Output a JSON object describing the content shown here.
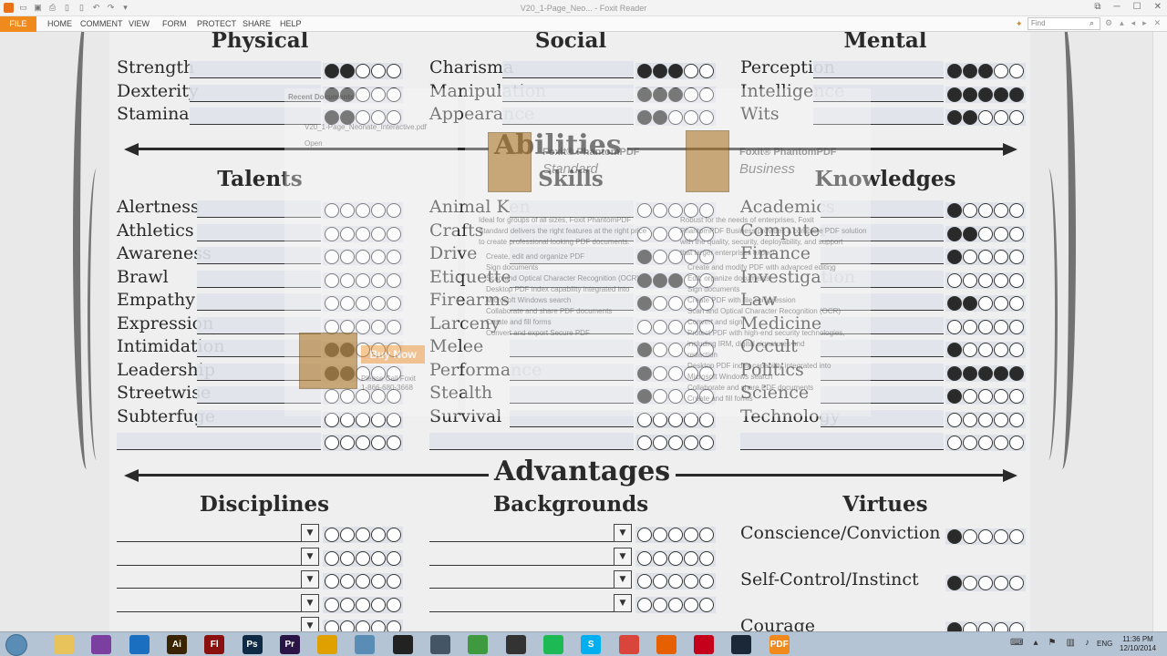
{
  "window": {
    "title": "V20_1-Page_Neo... - Foxit Reader",
    "controls": [
      "restore",
      "minimize",
      "maximize",
      "close"
    ]
  },
  "ribbon": {
    "file": "FILE",
    "tabs": [
      "HOME",
      "COMMENT",
      "VIEW",
      "FORM",
      "PROTECT",
      "SHARE",
      "HELP"
    ],
    "find_placeholder": "Find"
  },
  "sheet": {
    "attributes": {
      "headers": [
        "Physical",
        "Social",
        "Mental"
      ],
      "columns": [
        [
          {
            "label": "Strength",
            "filled": 2
          },
          {
            "label": "Dexterity",
            "filled": 2
          },
          {
            "label": "Stamina",
            "filled": 2
          }
        ],
        [
          {
            "label": "Charisma",
            "filled": 3
          },
          {
            "label": "Manipulation",
            "filled": 3
          },
          {
            "label": "Appearance",
            "filled": 2
          }
        ],
        [
          {
            "label": "Perception",
            "filled": 3
          },
          {
            "label": "Intelligence",
            "filled": 5
          },
          {
            "label": "Wits",
            "filled": 2
          }
        ]
      ]
    },
    "abilities": {
      "title": "Abilities",
      "headers": [
        "Talents",
        "Skills",
        "Knowledges"
      ],
      "columns": [
        [
          {
            "label": "Alertness",
            "filled": 0
          },
          {
            "label": "Athletics",
            "filled": 0
          },
          {
            "label": "Awareness",
            "filled": 0
          },
          {
            "label": "Brawl",
            "filled": 0
          },
          {
            "label": "Empathy",
            "filled": 0
          },
          {
            "label": "Expression",
            "filled": 0
          },
          {
            "label": "Intimidation",
            "filled": 2
          },
          {
            "label": "Leadership",
            "filled": 2
          },
          {
            "label": "Streetwise",
            "filled": 0
          },
          {
            "label": "Subterfuge",
            "filled": 0
          },
          {
            "label": "",
            "filled": 0
          }
        ],
        [
          {
            "label": "Animal Ken",
            "filled": 0
          },
          {
            "label": "Crafts",
            "filled": 0
          },
          {
            "label": "Drive",
            "filled": 1
          },
          {
            "label": "Etiquette",
            "filled": 3
          },
          {
            "label": "Firearms",
            "filled": 1
          },
          {
            "label": "Larceny",
            "filled": 0
          },
          {
            "label": "Melee",
            "filled": 1
          },
          {
            "label": "Performance",
            "filled": 1
          },
          {
            "label": "Stealth",
            "filled": 1
          },
          {
            "label": "Survival",
            "filled": 0
          },
          {
            "label": "",
            "filled": 0
          }
        ],
        [
          {
            "label": "Academics",
            "filled": 1
          },
          {
            "label": "Computer",
            "filled": 2
          },
          {
            "label": "Finance",
            "filled": 1
          },
          {
            "label": "Investigation",
            "filled": 0
          },
          {
            "label": "Law",
            "filled": 2
          },
          {
            "label": "Medicine",
            "filled": 0
          },
          {
            "label": "Occult",
            "filled": 1
          },
          {
            "label": "Politics",
            "filled": 5
          },
          {
            "label": "Science",
            "filled": 1
          },
          {
            "label": "Technology",
            "filled": 0
          },
          {
            "label": "",
            "filled": 0
          }
        ]
      ]
    },
    "advantages": {
      "title": "Advantages",
      "headers": [
        "Disciplines",
        "Backgrounds",
        "Virtues"
      ],
      "disciplines_rows": 5,
      "backgrounds_rows": 4,
      "virtues": [
        {
          "label": "Conscience/Conviction",
          "filled": 1
        },
        {
          "label": "Self-Control/Instinct",
          "filled": 1
        },
        {
          "label": "Courage",
          "filled": 1
        }
      ]
    }
  },
  "ghost_overlay": {
    "recent_title": "Recent Documents",
    "recent_file": "V20_1-Page_Neonate_Interactive.pdf",
    "open_label": "Open",
    "prod_standard_name": "Foxit® PhantomPDF",
    "prod_standard_edition": "Standard",
    "prod_business_name": "Foxit® PhantomPDF",
    "prod_business_edition": "Business",
    "standard_desc": [
      "Ideal for groups of all sizes, Foxit PhantomPDF",
      "Standard delivers the right features at the right price",
      "to create professional looking PDF documents."
    ],
    "standard_bullets": [
      "Create, edit and organize PDF",
      "Sign documents",
      "Scan and Optical Character Recognition (OCR)",
      "Desktop PDF index capability integrated into",
      "Microsoft Windows search",
      "Collaborate and share PDF documents",
      "Create and fill forms",
      "Convert and export Secure PDF"
    ],
    "business_desc": [
      "Robust for the needs of enterprises, Foxit",
      "PhantomPDF Business provides a complete PDF solution",
      "with the quality, security, deployability, and support",
      "that larger enterprises expect."
    ],
    "business_bullets": [
      "Create and modify PDF with advanced editing",
      "Edit, organize documents",
      "Sign documents",
      "Create PDF with file compression",
      "Scan and Optical Character Recognition (OCR)",
      "Convert and sign",
      "Protect PDF with high-end security technologies,",
      "including IRM, digital signatures and",
      "redaction",
      "Desktop PDF index capability integrated into",
      "Microsoft Windows search",
      "Collaborate and share PDF documents",
      "Create and fill forms"
    ],
    "buy_label": "Buy Now",
    "call_line1": "Please Call Foxit",
    "call_line2": "1-866-680-3668"
  },
  "taskbar": {
    "apps": [
      {
        "name": "explorer-icon",
        "glyph": "",
        "color": "#e8c25a"
      },
      {
        "name": "app-purple-icon",
        "glyph": "",
        "color": "#7b3fa0"
      },
      {
        "name": "app-blue-icon",
        "glyph": "",
        "color": "#1a6fc0"
      },
      {
        "name": "illustrator-icon",
        "glyph": "Ai",
        "color": "#3a2400"
      },
      {
        "name": "flash-icon",
        "glyph": "Fl",
        "color": "#8a1010"
      },
      {
        "name": "photoshop-icon",
        "glyph": "Ps",
        "color": "#0e2a45"
      },
      {
        "name": "premiere-icon",
        "glyph": "Pr",
        "color": "#2a1345"
      },
      {
        "name": "headphones-icon",
        "glyph": "",
        "color": "#e0a000"
      },
      {
        "name": "mail-icon",
        "glyph": "",
        "color": "#5a8db6"
      },
      {
        "name": "terminal-icon",
        "glyph": "",
        "color": "#222222"
      },
      {
        "name": "app-round-icon",
        "glyph": "",
        "color": "#445566"
      },
      {
        "name": "chart-app-icon",
        "glyph": "",
        "color": "#3f9a3f"
      },
      {
        "name": "app-dark-icon",
        "glyph": "",
        "color": "#333333"
      },
      {
        "name": "spotify-icon",
        "glyph": "",
        "color": "#1db954"
      },
      {
        "name": "skype-icon",
        "glyph": "S",
        "color": "#00aff0"
      },
      {
        "name": "chrome-icon",
        "glyph": "",
        "color": "#d9453b"
      },
      {
        "name": "firefox-icon",
        "glyph": "",
        "color": "#e66000"
      },
      {
        "name": "acrobat-icon",
        "glyph": "",
        "color": "#c4001a"
      },
      {
        "name": "app-steam-icon",
        "glyph": "",
        "color": "#1b2838"
      },
      {
        "name": "foxit-icon",
        "glyph": "PDF",
        "color": "#f08a1c"
      }
    ],
    "lang": "ENG",
    "time": "11:36 PM",
    "date": "12/10/2014"
  }
}
